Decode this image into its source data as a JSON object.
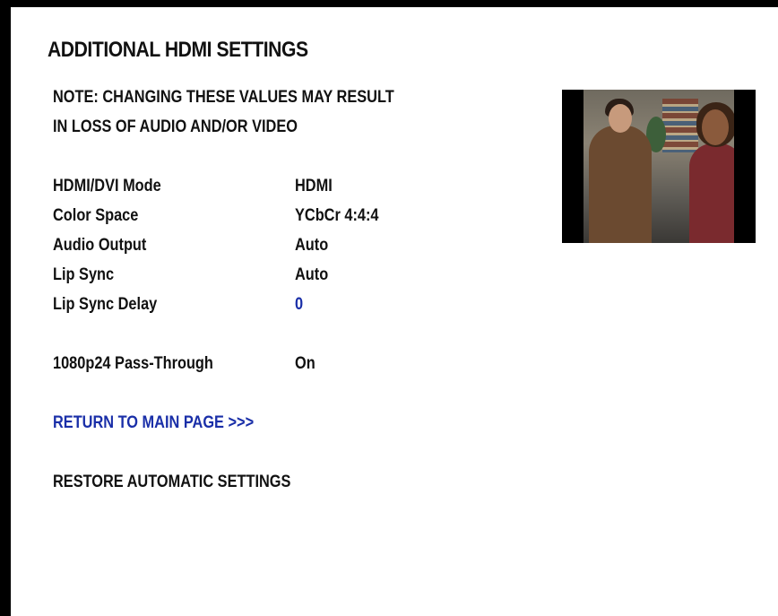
{
  "page": {
    "title": "ADDITIONAL HDMI SETTINGS",
    "note_line1": "NOTE: CHANGING THESE VALUES MAY RESULT",
    "note_line2": "IN LOSS OF AUDIO AND/OR VIDEO"
  },
  "settings": {
    "hdmi_mode": {
      "label": "HDMI/DVI Mode",
      "value": "HDMI"
    },
    "color_space": {
      "label": "Color Space",
      "value": "YCbCr 4:4:4"
    },
    "audio_output": {
      "label": "Audio Output",
      "value": "Auto"
    },
    "lip_sync": {
      "label": "Lip Sync",
      "value": "Auto"
    },
    "lip_sync_delay": {
      "label": "Lip Sync Delay",
      "value": "0"
    },
    "passthrough": {
      "label": "1080p24 Pass-Through",
      "value": "On"
    }
  },
  "links": {
    "return": "RETURN TO MAIN PAGE >>>",
    "restore": "RESTORE AUTOMATIC SETTINGS"
  },
  "colors": {
    "highlight": "#1a2fa8",
    "background": "#ffffff",
    "frame": "#000000"
  }
}
